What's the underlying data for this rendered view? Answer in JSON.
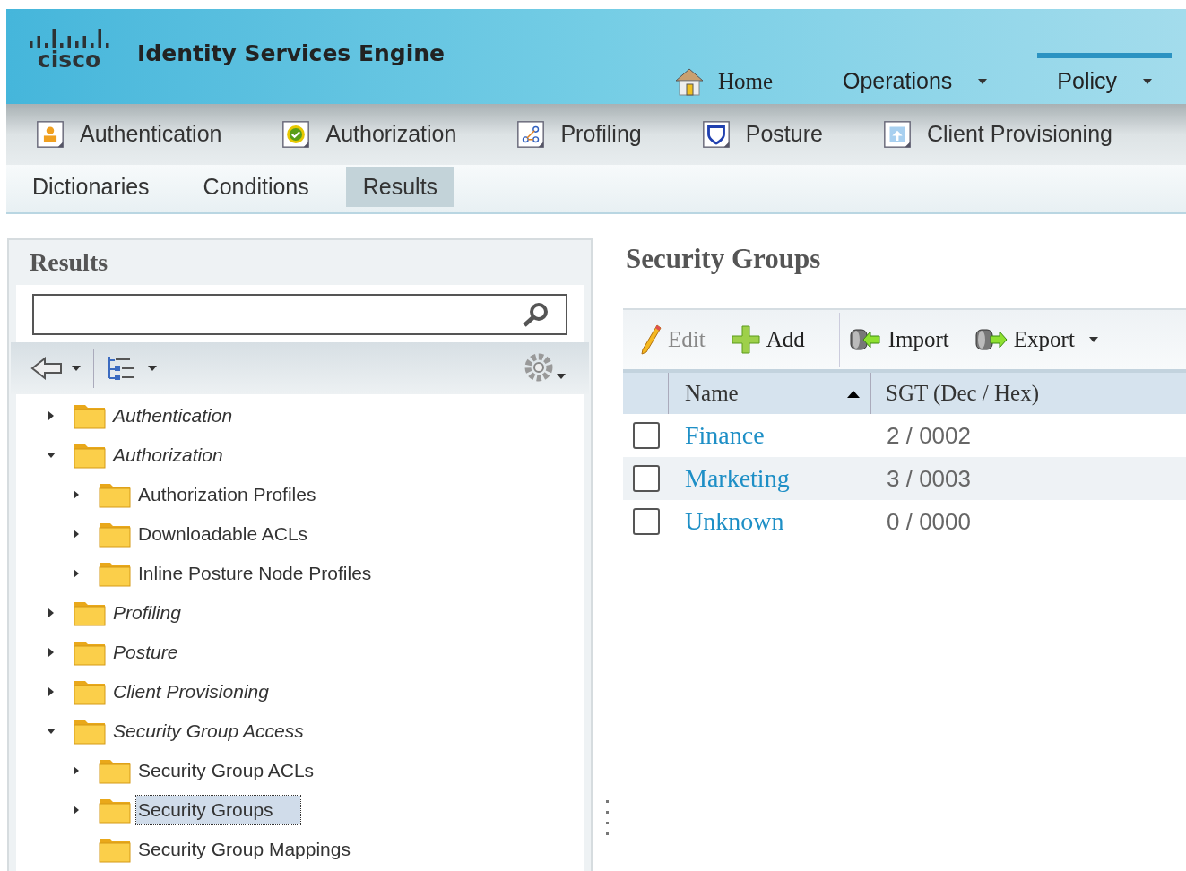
{
  "header": {
    "brand": "cisco",
    "title": "Identity Services Engine",
    "nav": [
      {
        "label": "Home",
        "kind": "home",
        "selected": false
      },
      {
        "label": "Operations",
        "kind": "menu",
        "selected": false
      },
      {
        "label": "Policy",
        "kind": "menu",
        "selected": true
      }
    ]
  },
  "tabs": [
    {
      "label": "Authentication"
    },
    {
      "label": "Authorization"
    },
    {
      "label": "Profiling"
    },
    {
      "label": "Posture"
    },
    {
      "label": "Client Provisioning"
    }
  ],
  "subtabs": [
    {
      "label": "Dictionaries",
      "selected": false
    },
    {
      "label": "Conditions",
      "selected": false
    },
    {
      "label": "Results",
      "selected": true
    }
  ],
  "sidebar": {
    "title": "Results",
    "tree": [
      {
        "label": "Authentication",
        "kind": "folder",
        "expanded": false,
        "selected": false
      },
      {
        "label": "Authorization",
        "kind": "folder",
        "expanded": true,
        "selected": false,
        "children": [
          {
            "label": "Authorization Profiles",
            "kind": "folder",
            "expanded": false,
            "selected": false
          },
          {
            "label": "Downloadable ACLs",
            "kind": "folder",
            "expanded": false,
            "selected": false
          },
          {
            "label": "Inline Posture Node Profiles",
            "kind": "folder",
            "expanded": false,
            "selected": false
          }
        ]
      },
      {
        "label": "Profiling",
        "kind": "folder",
        "expanded": false,
        "selected": false
      },
      {
        "label": "Posture",
        "kind": "folder",
        "expanded": false,
        "selected": false
      },
      {
        "label": "Client Provisioning",
        "kind": "folder",
        "expanded": false,
        "selected": false
      },
      {
        "label": "Security Group Access",
        "kind": "folder",
        "expanded": true,
        "selected": false,
        "children": [
          {
            "label": "Security Group ACLs",
            "kind": "folder",
            "expanded": false,
            "selected": false
          },
          {
            "label": "Security Groups",
            "kind": "folder",
            "expanded": false,
            "selected": true
          },
          {
            "label": "Security Group Mappings",
            "kind": "leaf",
            "selected": false
          }
        ]
      }
    ]
  },
  "main": {
    "title": "Security Groups",
    "toolbar": [
      {
        "label": "Edit",
        "kind": "edit",
        "disabled": true
      },
      {
        "label": "Add",
        "kind": "add",
        "disabled": false
      },
      {
        "label": "Import",
        "kind": "import",
        "disabled": false
      },
      {
        "label": "Export",
        "kind": "export",
        "disabled": false
      }
    ],
    "table": {
      "columns": [
        "Name",
        "SGT (Dec / Hex)"
      ],
      "rows": [
        {
          "name": "Finance",
          "sgt": "2 / 0002",
          "checked": false
        },
        {
          "name": "Marketing",
          "sgt": "3 / 0003",
          "checked": false
        },
        {
          "name": "Unknown",
          "sgt": "0 / 0000",
          "checked": false
        }
      ]
    }
  }
}
